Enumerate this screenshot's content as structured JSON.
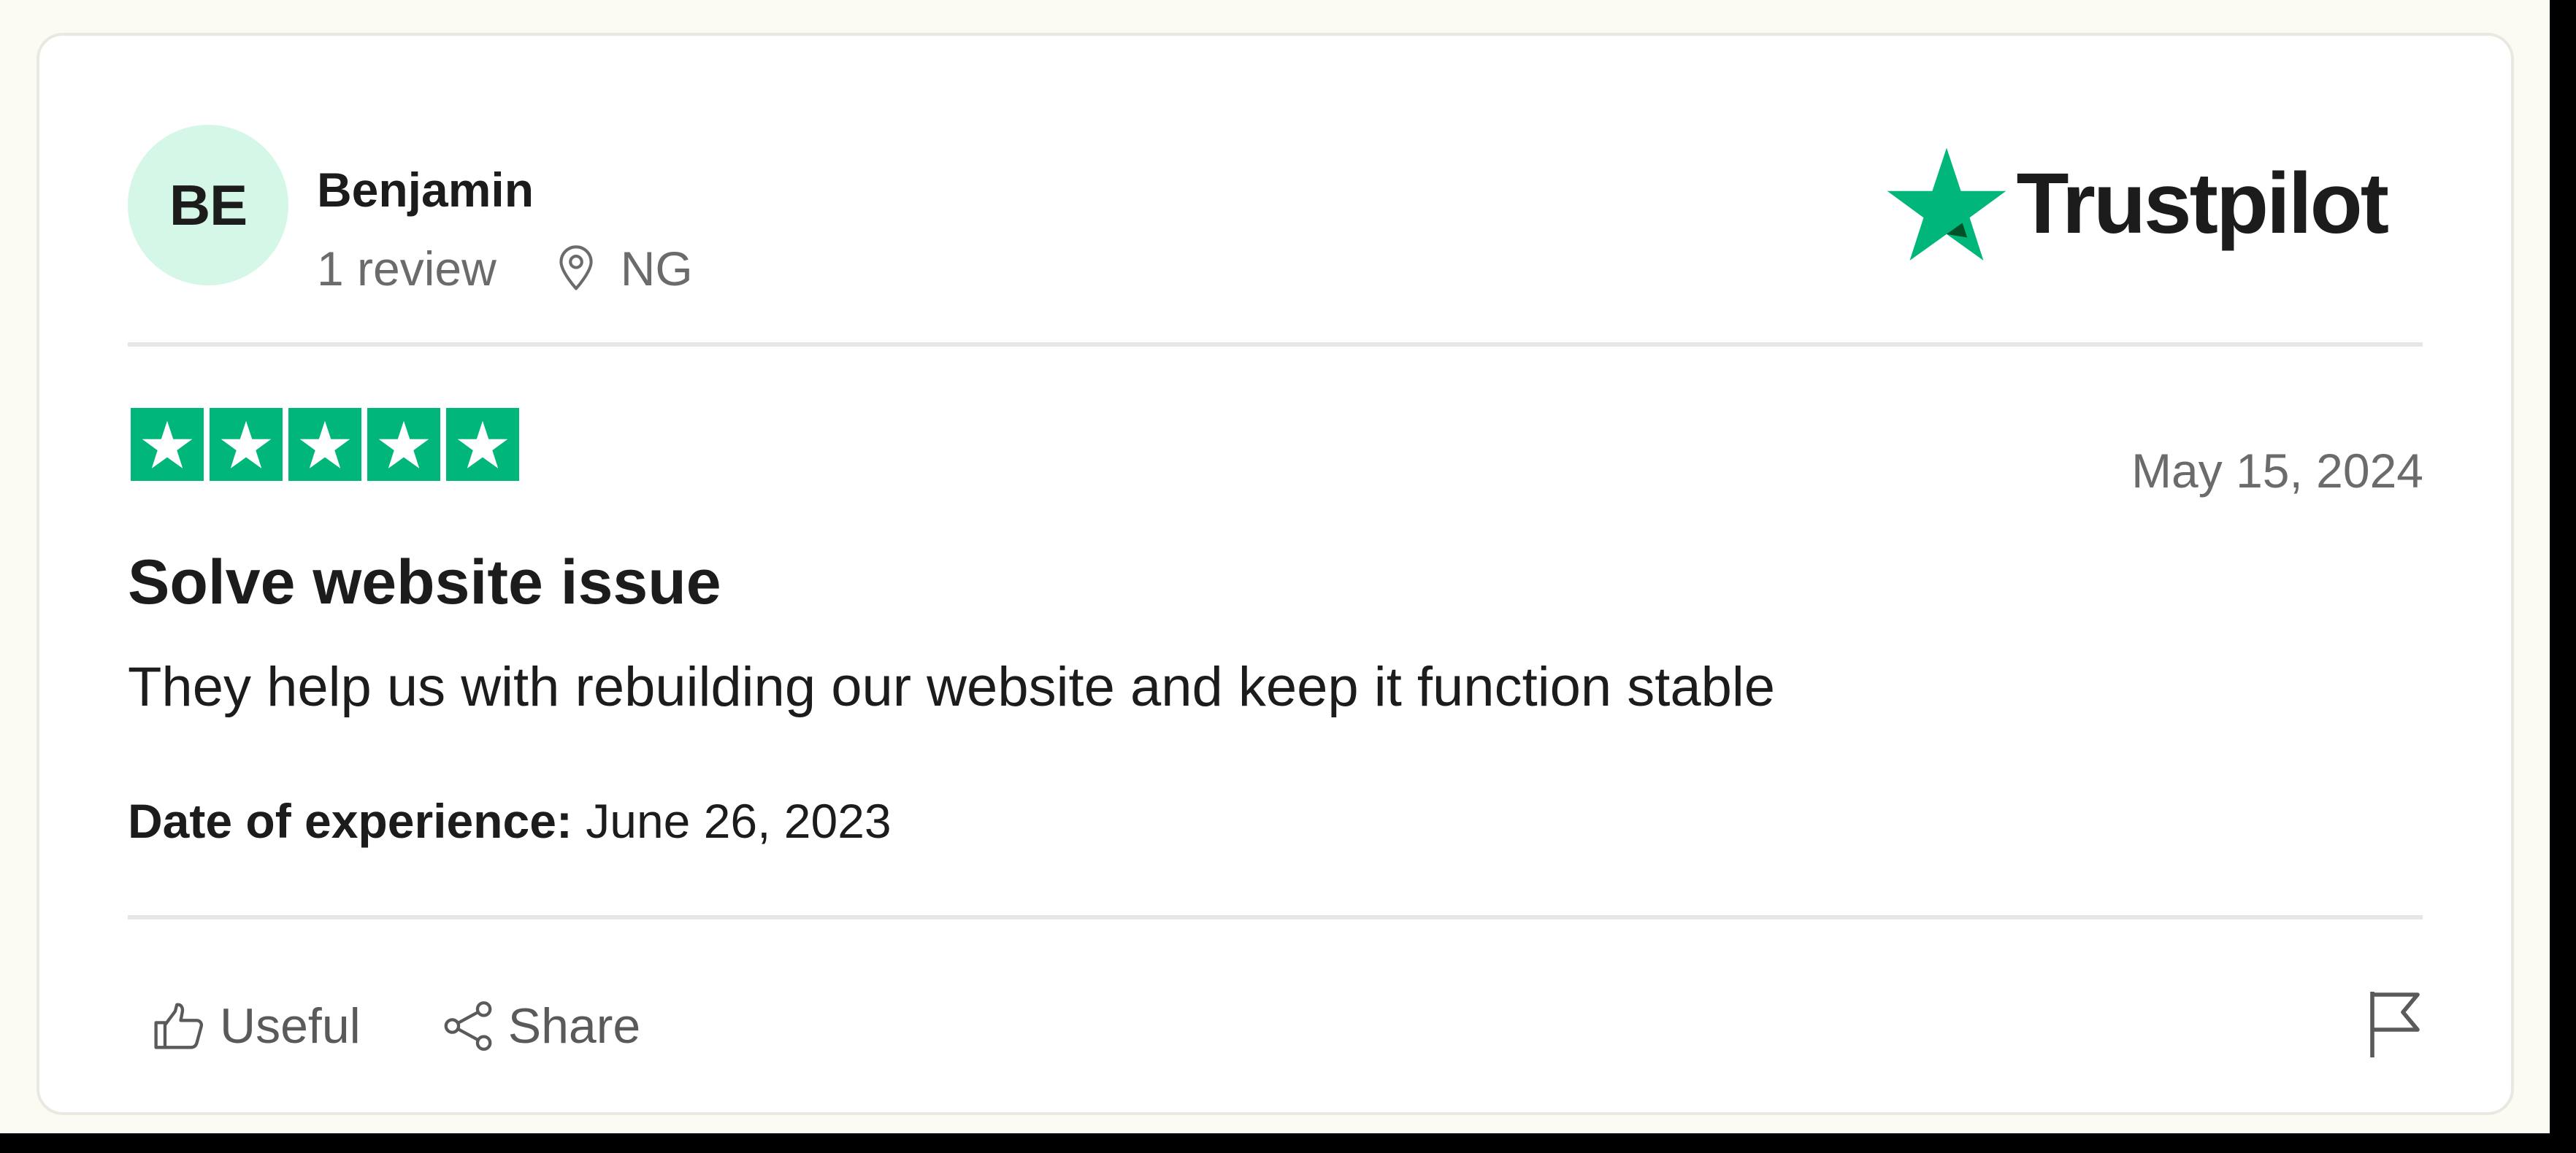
{
  "reviewer": {
    "initials": "BE",
    "name": "Benjamin",
    "review_count": "1 review",
    "location": "NG"
  },
  "brand": {
    "name": "Trustpilot",
    "accent_color": "#00b67a"
  },
  "review": {
    "rating": 5,
    "max_rating": 5,
    "date": "May 15, 2024",
    "title": "Solve website issue",
    "body": "They help us with rebuilding our website and keep it function stable",
    "experience_label": "Date of experience:",
    "experience_date": "June 26, 2023"
  },
  "actions": {
    "useful_label": "Useful",
    "share_label": "Share"
  },
  "icons": {
    "location": "location-pin-icon",
    "brand": "trustpilot-star-icon",
    "useful": "thumbs-up-icon",
    "share": "share-icon",
    "report": "flag-icon"
  },
  "colors": {
    "page_background": "#fbfbf4",
    "card_background": "#ffffff",
    "avatar_background": "#d5f7e7",
    "star_green": "#00b67a",
    "text_primary": "#1c1c1c",
    "text_secondary": "#6b6b6b"
  }
}
